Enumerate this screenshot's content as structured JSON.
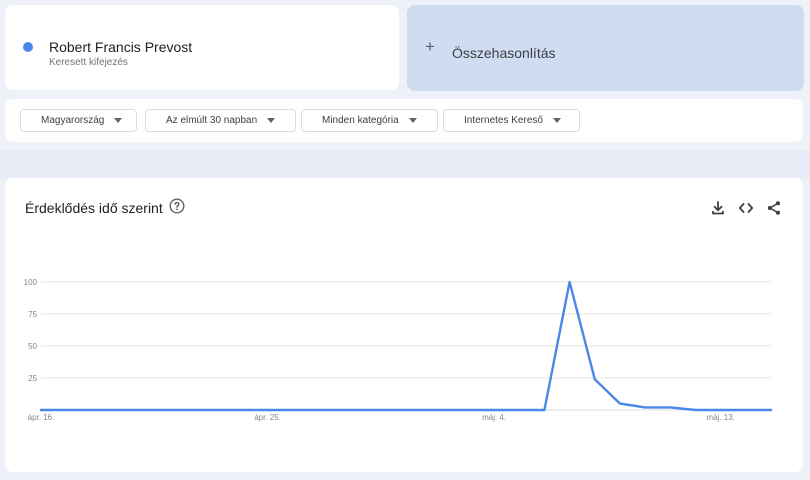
{
  "term": {
    "name": "Robert Francis Prevost",
    "subtitle": "Keresett kifejezés",
    "color": "#4a87e8"
  },
  "compare": {
    "label": "Összehasonlítás"
  },
  "filters": [
    {
      "label": "Magyarország"
    },
    {
      "label": "Az elmúlt 30 napban"
    },
    {
      "label": "Minden kategória"
    },
    {
      "label": "Internetes Kereső"
    }
  ],
  "chart": {
    "title": "Érdeklődés idő szerint",
    "icons": [
      "help-icon",
      "download-icon",
      "embed-icon",
      "share-icon"
    ]
  },
  "chart_data": {
    "type": "line",
    "title": "Érdeklődés idő szerint",
    "xlabel": "",
    "ylabel": "",
    "ylim": [
      0,
      100
    ],
    "yticks": [
      25,
      50,
      75,
      100
    ],
    "xtick_labels": [
      {
        "index": 0,
        "label": "ápr. 16."
      },
      {
        "index": 9,
        "label": "ápr. 25."
      },
      {
        "index": 18,
        "label": "máj. 4."
      },
      {
        "index": 27,
        "label": "máj. 13."
      }
    ],
    "grid": true,
    "series": [
      {
        "color": "#4a87e8",
        "values": [
          0,
          0,
          0,
          0,
          0,
          0,
          0,
          0,
          0,
          0,
          0,
          0,
          0,
          0,
          0,
          0,
          0,
          0,
          0,
          0,
          0,
          100,
          24,
          5,
          2,
          2,
          0,
          0,
          0,
          0
        ]
      }
    ]
  }
}
